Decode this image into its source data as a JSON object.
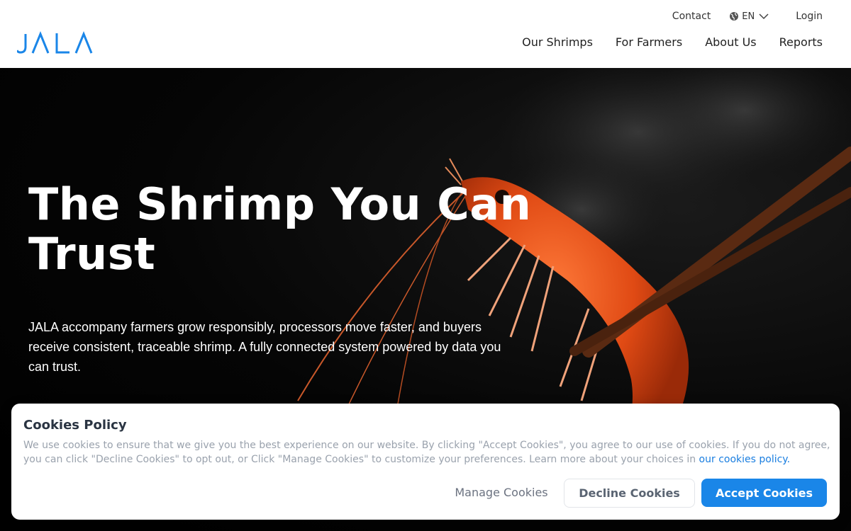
{
  "brand": {
    "logo_text": "JALA",
    "logo_color": "#1a86e8"
  },
  "topbar": {
    "contact": "Contact",
    "language": "EN",
    "login": "Login"
  },
  "nav": {
    "items": [
      "Our Shrimps",
      "For Farmers",
      "About Us",
      "Reports"
    ]
  },
  "hero": {
    "title": "The Shrimp You Can Trust",
    "description": "JALA accompany farmers grow responsibly, processors move faster, and buyers receive consistent, traceable shrimp. A fully connected system powered by data you can trust."
  },
  "cookie": {
    "title": "Cookies Policy",
    "text": "We use cookies to ensure that we give you the best experience on our website. By clicking \"Accept Cookies\", you agree to our use of cookies. If you do not agree, you can click \"Decline Cookies\" to opt out, or Click \"Manage Cookies\" to customize your preferences. Learn more about your choices in ",
    "link": "our cookies policy.",
    "manage": "Manage Cookies",
    "decline": "Decline Cookies",
    "accept": "Accept Cookies",
    "accent_color": "#1a86e8"
  }
}
